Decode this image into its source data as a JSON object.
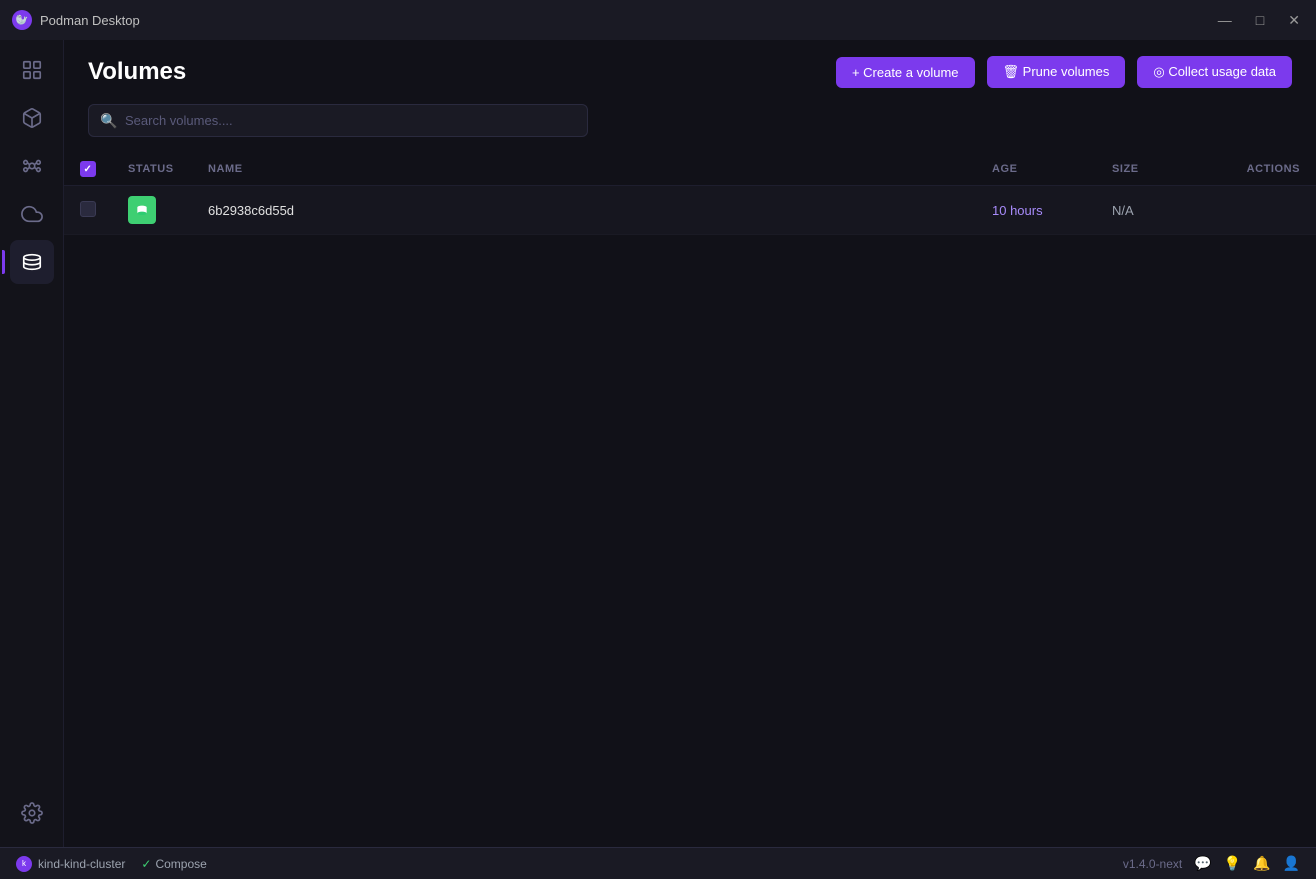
{
  "titlebar": {
    "app_name": "Podman Desktop",
    "logo": "🦭",
    "minimize_label": "—",
    "maximize_label": "□",
    "close_label": "✕"
  },
  "sidebar": {
    "items": [
      {
        "id": "dashboard",
        "label": "Dashboard",
        "icon": "grid"
      },
      {
        "id": "containers",
        "label": "Containers",
        "icon": "box"
      },
      {
        "id": "pods",
        "label": "Pods",
        "icon": "pods"
      },
      {
        "id": "images",
        "label": "Images",
        "icon": "cloud"
      },
      {
        "id": "volumes",
        "label": "Volumes",
        "icon": "cylinder",
        "active": true
      }
    ],
    "settings_label": "Settings"
  },
  "page": {
    "title": "Volumes"
  },
  "toolbar": {
    "create_label": "+ Create a volume",
    "prune_label": "🗑 Prune volumes",
    "collect_label": "◎ Collect usage data"
  },
  "search": {
    "placeholder": "Search volumes...."
  },
  "table": {
    "columns": {
      "status": "STATUS",
      "name": "NAME",
      "age": "AGE",
      "size": "SIZE",
      "actions": "ACTIONS"
    },
    "rows": [
      {
        "id": "row-1",
        "selected": false,
        "status": "running",
        "name": "6b2938c6d55d",
        "age": "10 hours",
        "size": "N/A"
      }
    ]
  },
  "footer": {
    "cluster_name": "kind-kind-cluster",
    "compose_label": "Compose",
    "version": "v1.4.0-next",
    "check_icon": "✓"
  }
}
